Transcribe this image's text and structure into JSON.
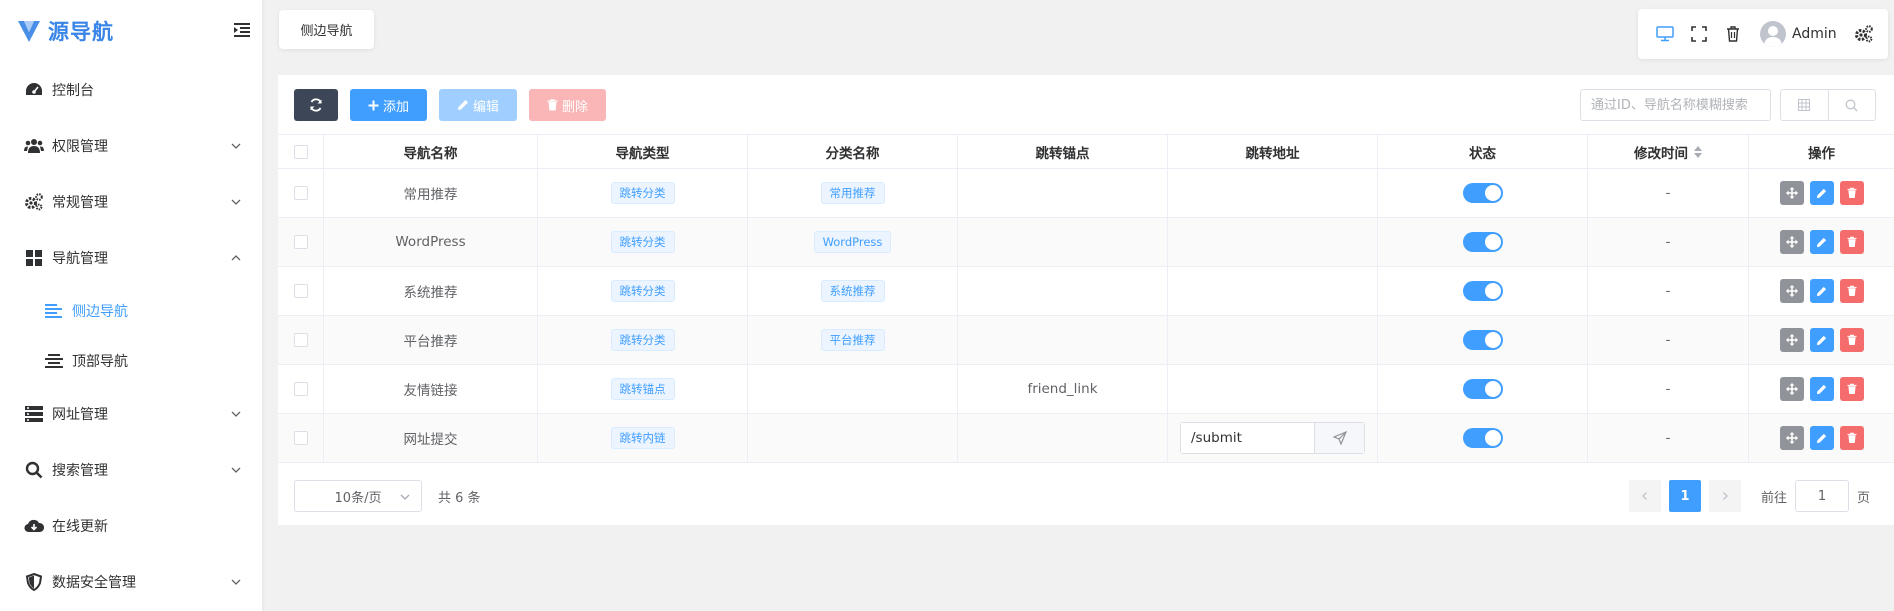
{
  "brand": {
    "name": "源导航",
    "accent": "#409eff"
  },
  "sidebar": {
    "items": [
      {
        "label": "控制台",
        "icon": "dashboard-icon"
      },
      {
        "label": "权限管理",
        "icon": "users-icon"
      },
      {
        "label": "常规管理",
        "icon": "cogs-icon"
      },
      {
        "label": "导航管理",
        "icon": "grid-icon"
      },
      {
        "label": "网址管理",
        "icon": "server-icon"
      },
      {
        "label": "搜索管理",
        "icon": "search-icon"
      },
      {
        "label": "在线更新",
        "icon": "cloud-download-icon"
      },
      {
        "label": "数据安全管理",
        "icon": "shield-icon"
      }
    ],
    "sub_items": [
      {
        "label": "侧边导航",
        "icon": "align-left-icon",
        "active": true
      },
      {
        "label": "顶部导航",
        "icon": "align-center-icon",
        "active": false
      }
    ]
  },
  "tabs": {
    "active": "侧边导航"
  },
  "header": {
    "user": "Admin"
  },
  "toolbar": {
    "add_label": "添加",
    "edit_label": "编辑",
    "delete_label": "删除",
    "search_placeholder": "通过ID、导航名称模糊搜索"
  },
  "table": {
    "columns": [
      "导航名称",
      "导航类型",
      "分类名称",
      "跳转锚点",
      "跳转地址",
      "状态",
      "修改时间",
      "操作"
    ],
    "rows": [
      {
        "name": "常用推荐",
        "type": "跳转分类",
        "category": "常用推荐",
        "anchor": "",
        "url": "",
        "status": true,
        "modified": "-"
      },
      {
        "name": "WordPress",
        "type": "跳转分类",
        "category": "WordPress",
        "anchor": "",
        "url": "",
        "status": true,
        "modified": "-"
      },
      {
        "name": "系统推荐",
        "type": "跳转分类",
        "category": "系统推荐",
        "anchor": "",
        "url": "",
        "status": true,
        "modified": "-"
      },
      {
        "name": "平台推荐",
        "type": "跳转分类",
        "category": "平台推荐",
        "anchor": "",
        "url": "",
        "status": true,
        "modified": "-"
      },
      {
        "name": "友情链接",
        "type": "跳转锚点",
        "category": "",
        "anchor": "friend_link",
        "url": "",
        "status": true,
        "modified": "-"
      },
      {
        "name": "网址提交",
        "type": "跳转内链",
        "category": "",
        "anchor": "",
        "url": "/submit",
        "status": true,
        "modified": "-"
      }
    ]
  },
  "pagination": {
    "page_size": "10条/页",
    "total": "共 6 条",
    "current": "1",
    "goto_label": "前往",
    "goto_value": "1",
    "page_unit": "页"
  }
}
